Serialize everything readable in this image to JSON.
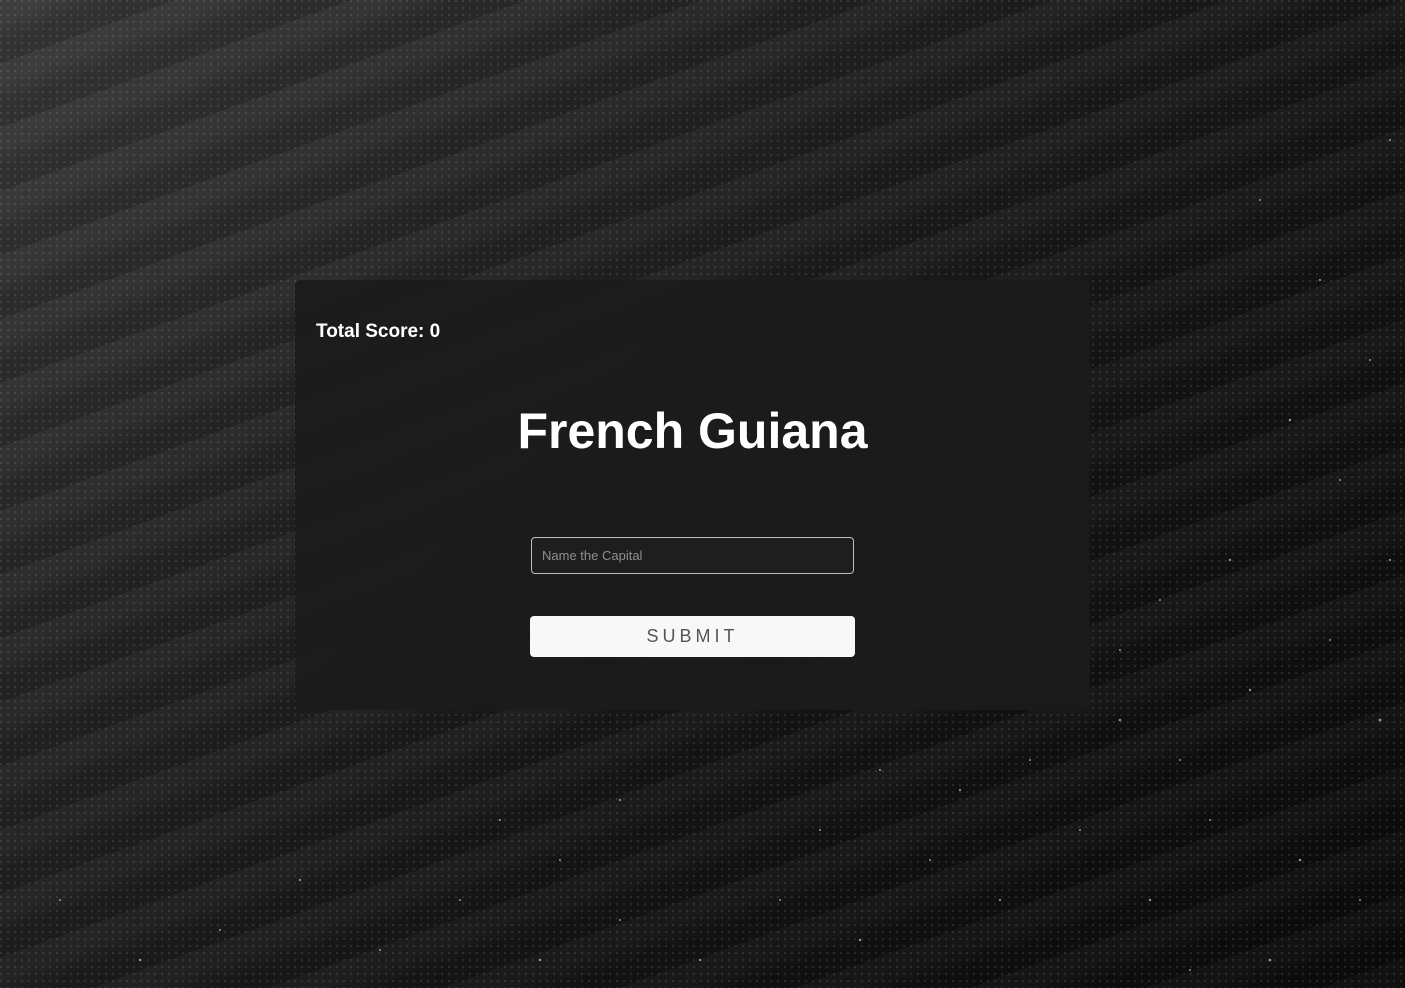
{
  "score": {
    "label": "Total Score: 0"
  },
  "question": {
    "country": "French Guiana"
  },
  "answer": {
    "placeholder": "Name the Capital",
    "value": ""
  },
  "actions": {
    "submit_label": "SUBMIT"
  },
  "colors": {
    "background": "#141414",
    "card": "#1b1b1b",
    "text": "#ffffff",
    "button_bg": "#f8f8f8",
    "button_text": "#555555"
  }
}
